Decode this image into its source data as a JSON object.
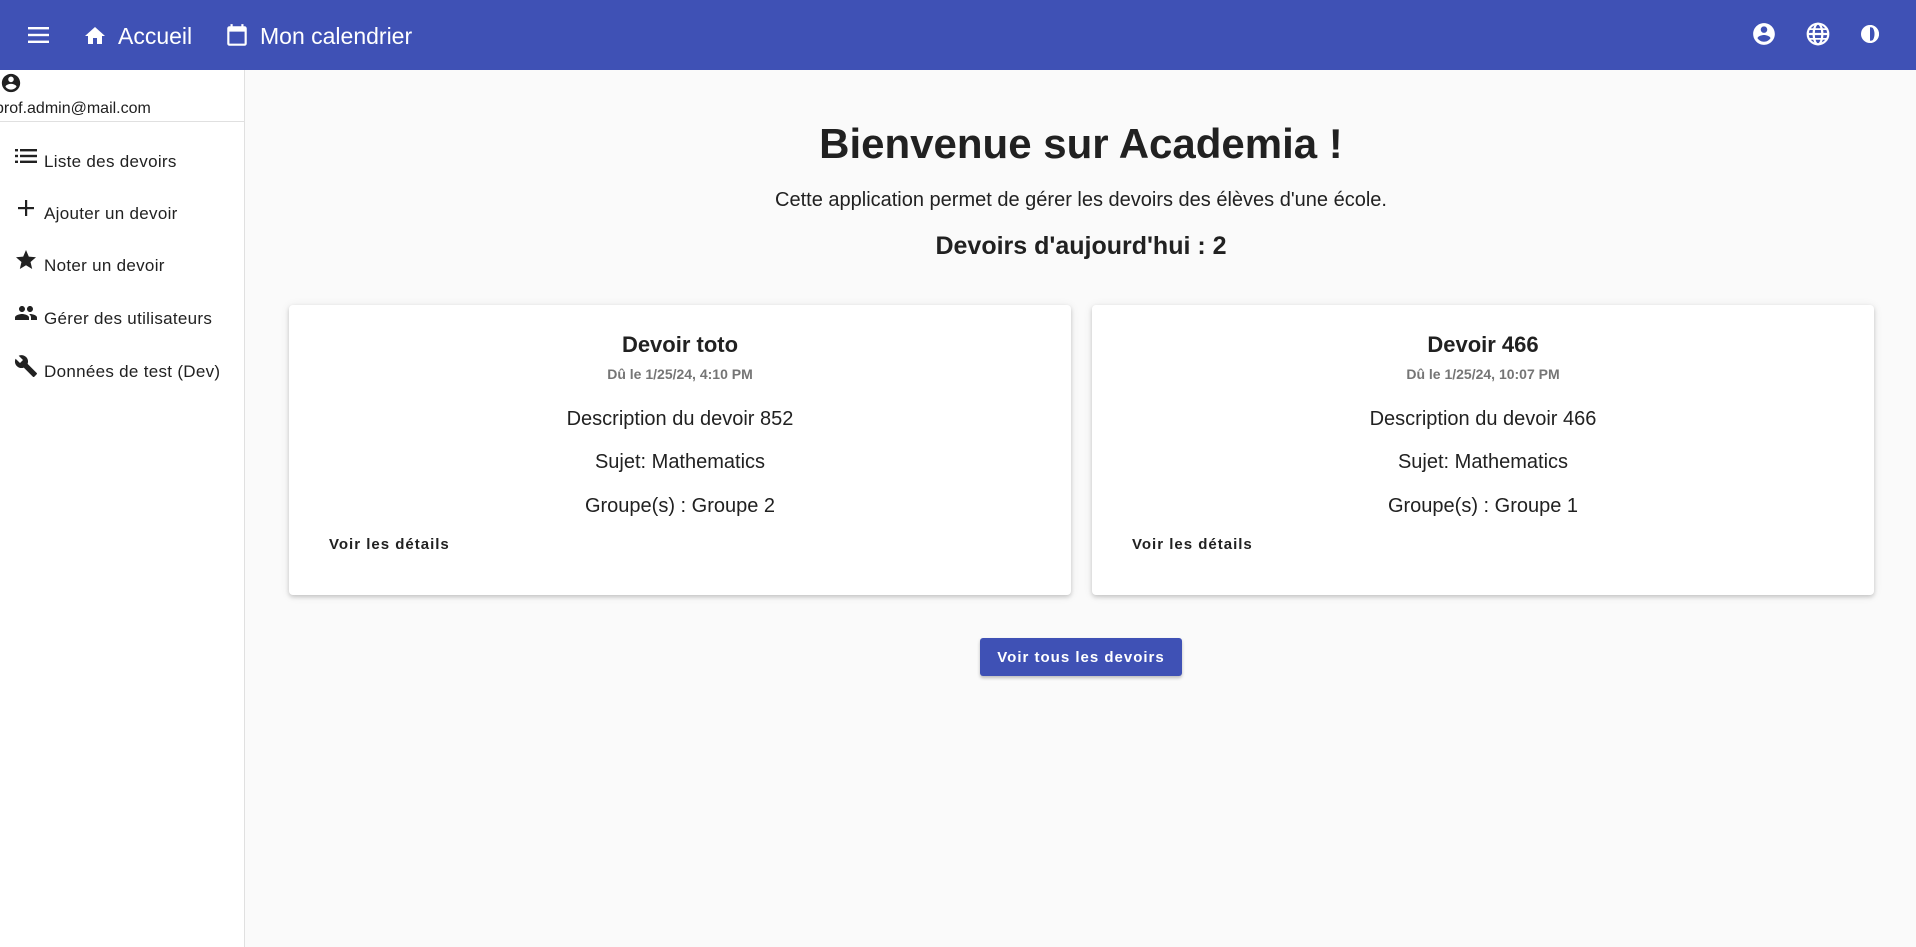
{
  "header": {
    "menu_icon": "menu-icon",
    "home": {
      "icon": "home-icon",
      "label": "Accueil"
    },
    "calendar": {
      "icon": "calendar-icon",
      "label": "Mon calendrier"
    },
    "right_icons": [
      "account-circle-icon",
      "globe-icon",
      "dark-mode-icon"
    ],
    "accent_color": "#3f51b5"
  },
  "sidebar": {
    "user_email": "prof.admin@mail.com",
    "items": [
      {
        "icon": "list-icon",
        "label": "Liste des devoirs"
      },
      {
        "icon": "plus-icon",
        "label": "Ajouter un devoir"
      },
      {
        "icon": "star-icon",
        "label": "Noter un devoir"
      },
      {
        "icon": "people-icon",
        "label": "Gérer des utilisateurs"
      },
      {
        "icon": "wrench-icon",
        "label": "Données de test (Dev)"
      }
    ]
  },
  "main": {
    "welcome_title": "Bienvenue sur Academia !",
    "intro_text": "Cette application permet de gérer les devoirs des élèves d'une école.",
    "today_heading": "Devoirs d'aujourd'hui : 2",
    "cards": [
      {
        "title": "Devoir toto",
        "due": "Dû le 1/25/24, 4:10 PM",
        "description": "Description du devoir 852",
        "subject": "Sujet: Mathematics",
        "groups": "Groupe(s) : Groupe 2",
        "details_label": "Voir les détails"
      },
      {
        "title": "Devoir 466",
        "due": "Dû le 1/25/24, 10:07 PM",
        "description": "Description du devoir 466",
        "subject": "Sujet: Mathematics",
        "groups": "Groupe(s) : Groupe 1",
        "details_label": "Voir les détails"
      }
    ],
    "all_button_label": "Voir tous les devoirs"
  }
}
